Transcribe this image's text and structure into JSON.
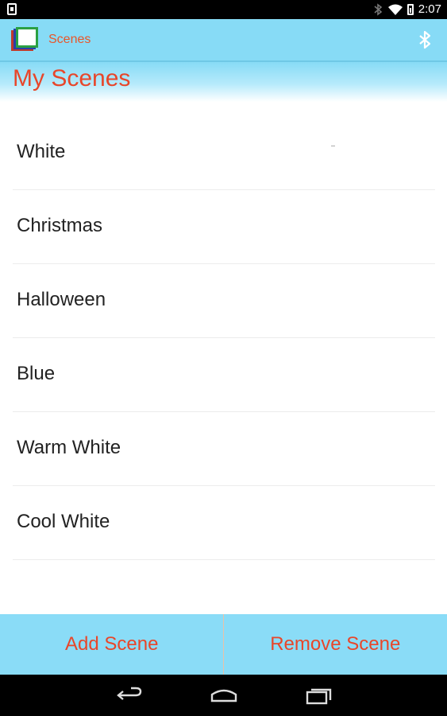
{
  "status_bar": {
    "time": "2:07",
    "icons": [
      "phone-icon",
      "bluetooth-icon",
      "wifi-icon",
      "battery-icon"
    ]
  },
  "action_bar": {
    "title": "Scenes",
    "app_icon": "scenes-app-icon",
    "right_icon": "bluetooth-icon"
  },
  "page": {
    "title": "My Scenes"
  },
  "scenes": [
    {
      "label": "White"
    },
    {
      "label": "Christmas"
    },
    {
      "label": "Halloween"
    },
    {
      "label": "Blue"
    },
    {
      "label": "Warm White"
    },
    {
      "label": "Cool White"
    }
  ],
  "buttons": {
    "add": "Add Scene",
    "remove": "Remove Scene"
  },
  "nav_bar": {
    "icons": [
      "back-icon",
      "home-icon",
      "recent-apps-icon"
    ]
  },
  "colors": {
    "accent": "#e8462a",
    "bar": "#87dbf6"
  }
}
